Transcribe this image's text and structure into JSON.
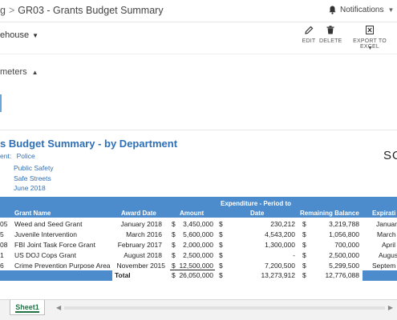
{
  "titlebar": {
    "breadcrumb_prev": "g",
    "separator": ">",
    "title": "GR03 - Grants Budget Summary",
    "notifications_label": "Notifications"
  },
  "toolbar": {
    "warehouse_label": "ehouse",
    "edit_label": "EDIT",
    "delete_label": "DELETE",
    "export_label": "EXPORT TO EXCEL"
  },
  "parameters": {
    "label": "meters"
  },
  "report": {
    "title": "s Budget Summary - by Department",
    "logo_text": "SO",
    "department_label": "ent:",
    "department_value": "Police",
    "departments_extra": [
      "Public Safety",
      "Safe Streets"
    ],
    "period": "June 2018"
  },
  "table": {
    "headers": {
      "grant_name": "Grant Name",
      "award_date": "Award Date",
      "amount": "Amount",
      "expenditure_line1": "Expenditure - Period to",
      "expenditure_line2": "Date",
      "remaining": "Remaining Balance",
      "expiration": "Expirati"
    },
    "currency_symbol": "$",
    "rows": [
      {
        "id": "05",
        "name": "Weed and Seed Grant",
        "award_date": "January 2018",
        "amount": "3,450,000",
        "expenditure": "230,212",
        "remaining": "3,219,788",
        "expiration": "Januar"
      },
      {
        "id": "5",
        "name": "Juvenile Intervention",
        "award_date": "March 2016",
        "amount": "5,600,000",
        "expenditure": "4,543,200",
        "remaining": "1,056,800",
        "expiration": "March"
      },
      {
        "id": "08",
        "name": "FBI Joint Task Force Grant",
        "award_date": "February 2017",
        "amount": "2,000,000",
        "expenditure": "1,300,000",
        "remaining": "700,000",
        "expiration": "April"
      },
      {
        "id": "1",
        "name": "US DOJ Cops Grant",
        "award_date": "August 2018",
        "amount": "2,500,000",
        "expenditure": "-",
        "remaining": "2,500,000",
        "expiration": "Augus"
      },
      {
        "id": "6",
        "name": "Crime Prevention Purpose Area",
        "award_date": "November 2015",
        "amount": "12,500,000",
        "expenditure": "7,200,500",
        "remaining": "5,299,500",
        "expiration": "Septem"
      }
    ],
    "total": {
      "label": "Total",
      "amount": "26,050,000",
      "expenditure": "13,273,912",
      "remaining": "12,776,088"
    }
  },
  "sheets": {
    "tabs": [
      "Sheet1"
    ]
  },
  "colors": {
    "header_blue": "#4d8ccc",
    "title_blue": "#2e6fb7",
    "excel_green": "#217346"
  }
}
